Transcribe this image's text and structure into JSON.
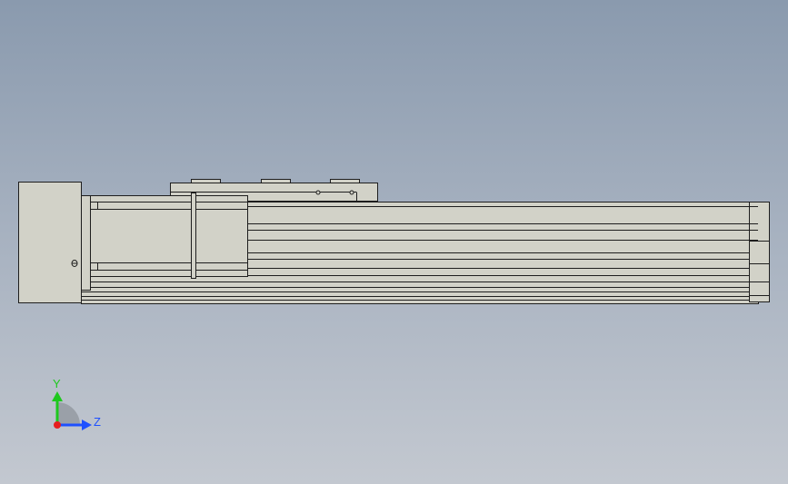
{
  "viewport": {
    "background_top": "#8a9aae",
    "background_bottom": "#c3c8d0",
    "part_color": "#d2d2c8",
    "edge_color": "#1e1e1e"
  },
  "triad": {
    "y_label": "Y",
    "z_label": "Z",
    "y_color": "#1ec81e",
    "z_color": "#1e50ff",
    "x_color": "#e61e1e"
  }
}
